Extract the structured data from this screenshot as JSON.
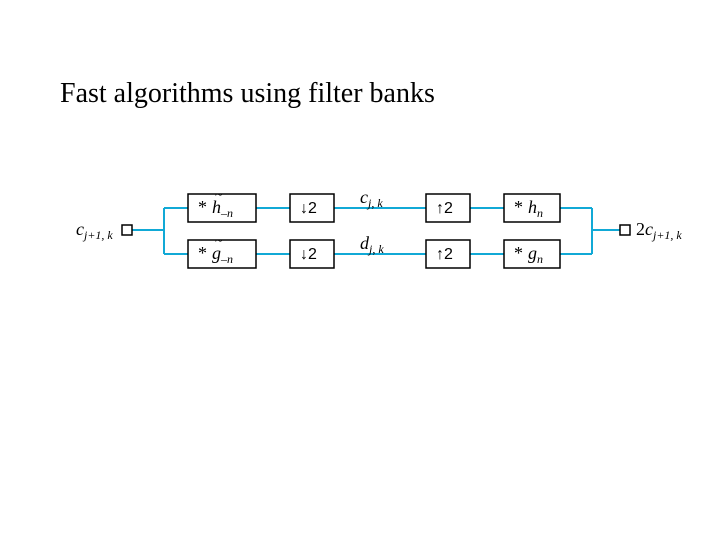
{
  "title": "Fast algorithms using filter banks",
  "input_label": {
    "base": "c",
    "sub": "j+1, k"
  },
  "output_label": {
    "pre": "2",
    "base": "c",
    "sub": "j+1, k"
  },
  "top_path": {
    "analysis_filter": {
      "op": "*",
      "tilde": true,
      "base": "h",
      "sub": "–n"
    },
    "down": "↓2",
    "mid": {
      "base": "c",
      "sub": "j, k"
    },
    "up": "↑2",
    "synth_filter": {
      "op": "*",
      "tilde": false,
      "base": "h",
      "sub": "n"
    }
  },
  "bot_path": {
    "analysis_filter": {
      "op": "*",
      "tilde": true,
      "base": "g",
      "sub": "–n"
    },
    "down": "↓2",
    "mid": {
      "base": "d",
      "sub": "j, k"
    },
    "up": "↑2",
    "synth_filter": {
      "op": "*",
      "tilde": false,
      "base": "g",
      "sub": "n"
    }
  },
  "colors": {
    "wire": "#11a9d6"
  }
}
